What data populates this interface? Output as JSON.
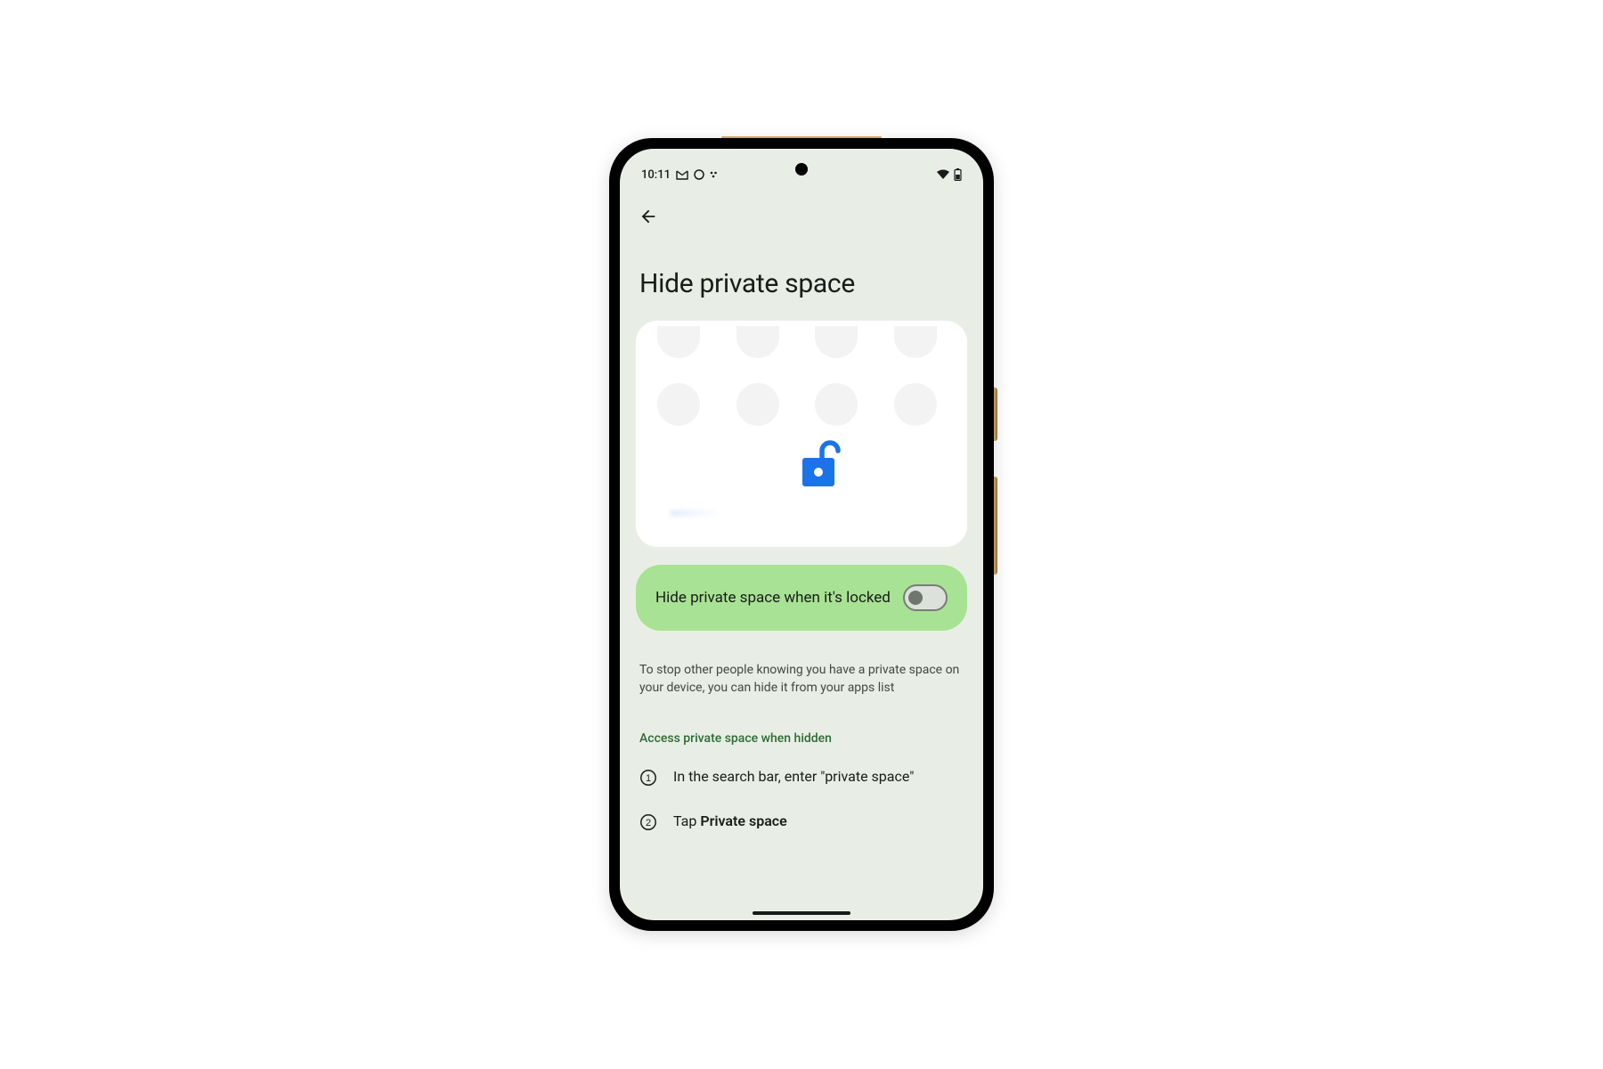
{
  "status_bar": {
    "time": "10:11",
    "icons_left": [
      "gmail-icon",
      "circle-icon",
      "colon-icon"
    ],
    "icons_right": [
      "wifi-icon",
      "battery-icon"
    ]
  },
  "page": {
    "title": "Hide private space"
  },
  "toggle": {
    "label": "Hide private space when it's locked",
    "state": "off"
  },
  "description": "To stop other people knowing you have a private space on your device, you can hide it from your apps list",
  "section_header": "Access private space when hidden",
  "steps": [
    {
      "number": "1",
      "text_prefix": "In the search bar, enter \"private space\"",
      "text_bold": ""
    },
    {
      "number": "2",
      "text_prefix": "Tap ",
      "text_bold": "Private space"
    }
  ],
  "colors": {
    "screen_bg": "#e8eee5",
    "card_bg": "#ffffff",
    "toggle_bg": "#a8e294",
    "lock_blue": "#1a73e8",
    "section_green": "#2e6b34"
  }
}
